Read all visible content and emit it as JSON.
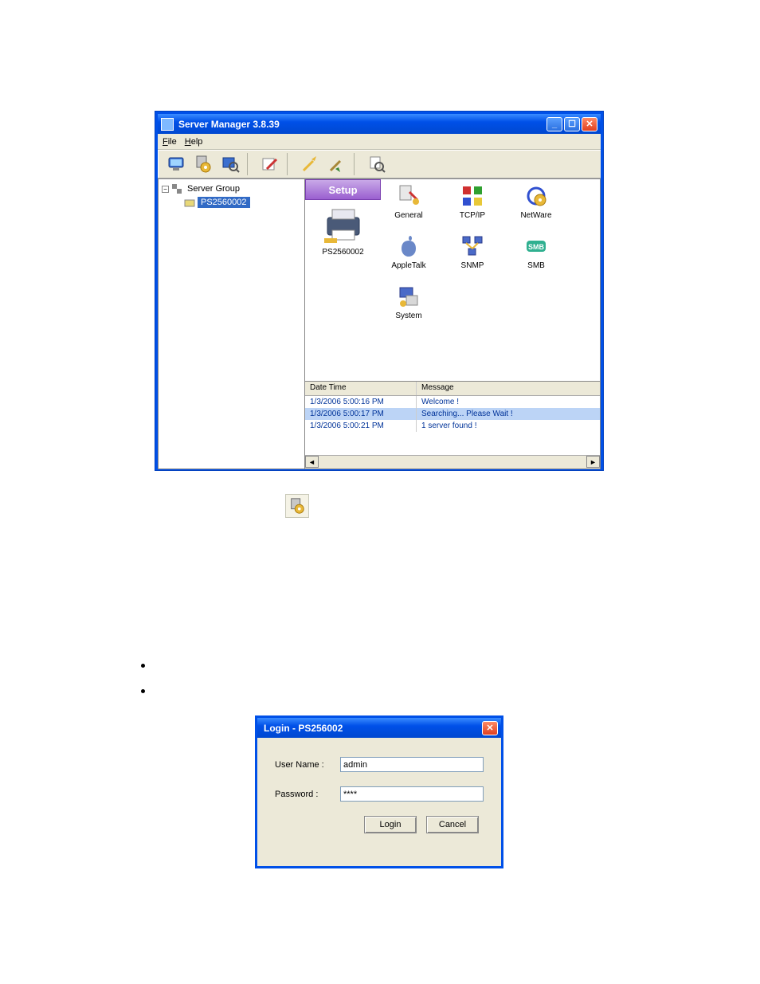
{
  "main_window": {
    "title": "Server Manager 3.8.39",
    "menu": {
      "file": "File",
      "help": "Help"
    },
    "tree": {
      "root": "Server Group",
      "child": "PS2560002"
    },
    "setup_header": "Setup",
    "printer_caption": "PS2560002",
    "icons": {
      "general": "General",
      "tcpip": "TCP/IP",
      "netware": "NetWare",
      "appletalk": "AppleTalk",
      "snmp": "SNMP",
      "smb": "SMB",
      "system": "System"
    },
    "log": {
      "col_datetime": "Date Time",
      "col_message": "Message",
      "rows": [
        {
          "dt": "1/3/2006 5:00:16 PM",
          "msg": "Welcome !"
        },
        {
          "dt": "1/3/2006 5:00:17 PM",
          "msg": "Searching... Please Wait !"
        },
        {
          "dt": "1/3/2006 5:00:21 PM",
          "msg": "1 server found !"
        }
      ]
    }
  },
  "login_dialog": {
    "title": "Login - PS256002",
    "username_label": "User Name :",
    "password_label": "Password :",
    "username_value": "admin",
    "password_value": "****",
    "login_btn": "Login",
    "cancel_btn": "Cancel"
  }
}
